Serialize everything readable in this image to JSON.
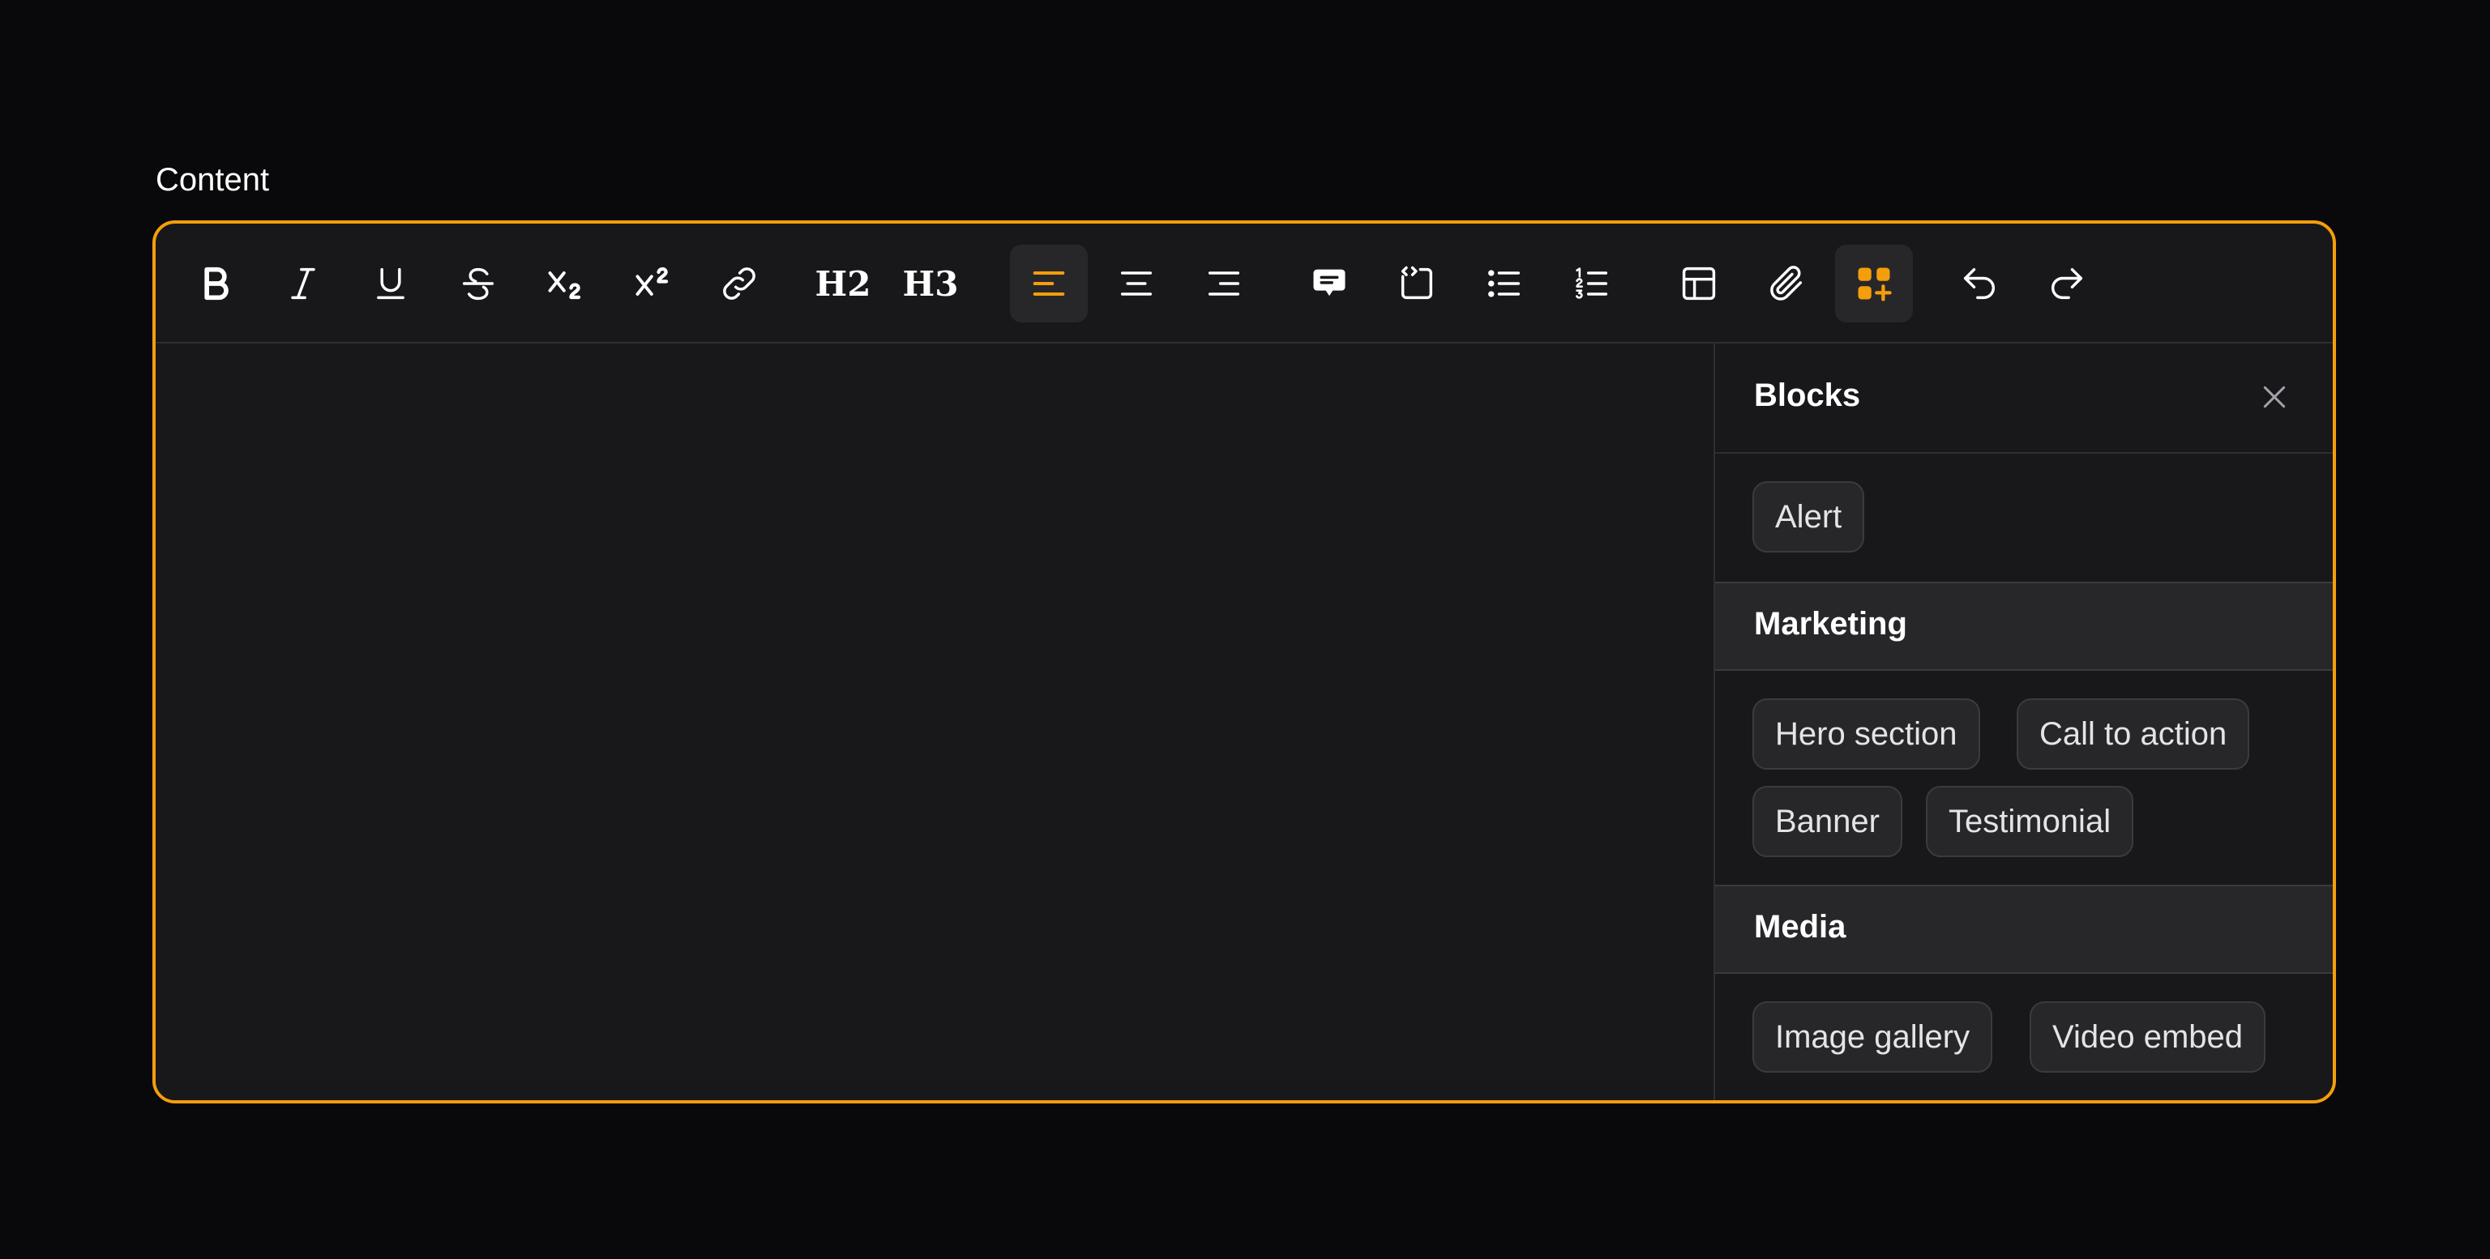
{
  "field": {
    "label": "Content"
  },
  "colors": {
    "accent": "#f59e0b",
    "background": "#09090b",
    "surface": "#18181b",
    "chip": "#27272a"
  },
  "toolbar": {
    "buttons": [
      {
        "name": "bold-button",
        "icon": "bold-icon"
      },
      {
        "name": "italic-button",
        "icon": "italic-icon"
      },
      {
        "name": "underline-button",
        "icon": "underline-icon"
      },
      {
        "name": "strikethrough-button",
        "icon": "strikethrough-icon"
      },
      {
        "name": "subscript-button",
        "icon": "subscript-icon"
      },
      {
        "name": "superscript-button",
        "icon": "superscript-icon"
      },
      {
        "name": "link-button",
        "icon": "link-icon"
      },
      {
        "name": "heading-2-button",
        "icon": "heading-2-icon"
      },
      {
        "name": "heading-3-button",
        "icon": "heading-3-icon"
      },
      {
        "name": "align-left-button",
        "icon": "align-left-icon",
        "active": true
      },
      {
        "name": "align-center-button",
        "icon": "align-center-icon"
      },
      {
        "name": "align-right-button",
        "icon": "align-right-icon"
      },
      {
        "name": "blockquote-button",
        "icon": "quote-bubble-icon"
      },
      {
        "name": "code-block-button",
        "icon": "code-block-icon"
      },
      {
        "name": "bullet-list-button",
        "icon": "bullet-list-icon"
      },
      {
        "name": "ordered-list-button",
        "icon": "ordered-list-icon"
      },
      {
        "name": "table-button",
        "icon": "table-icon"
      },
      {
        "name": "attach-files-button",
        "icon": "paperclip-icon"
      },
      {
        "name": "blocks-button",
        "icon": "blocks-add-icon",
        "active": true
      },
      {
        "name": "undo-button",
        "icon": "undo-icon"
      },
      {
        "name": "redo-button",
        "icon": "redo-icon"
      }
    ],
    "h2_text": "H2",
    "h3_text": "H3"
  },
  "blocks_panel": {
    "title": "Blocks",
    "close_icon": "close-icon",
    "ungrouped": [
      "Alert"
    ],
    "groups": [
      {
        "label": "Marketing",
        "items": [
          "Hero section",
          "Call to action",
          "Banner",
          "Testimonial"
        ]
      },
      {
        "label": "Media",
        "items": [
          "Image gallery",
          "Video embed"
        ]
      }
    ]
  }
}
